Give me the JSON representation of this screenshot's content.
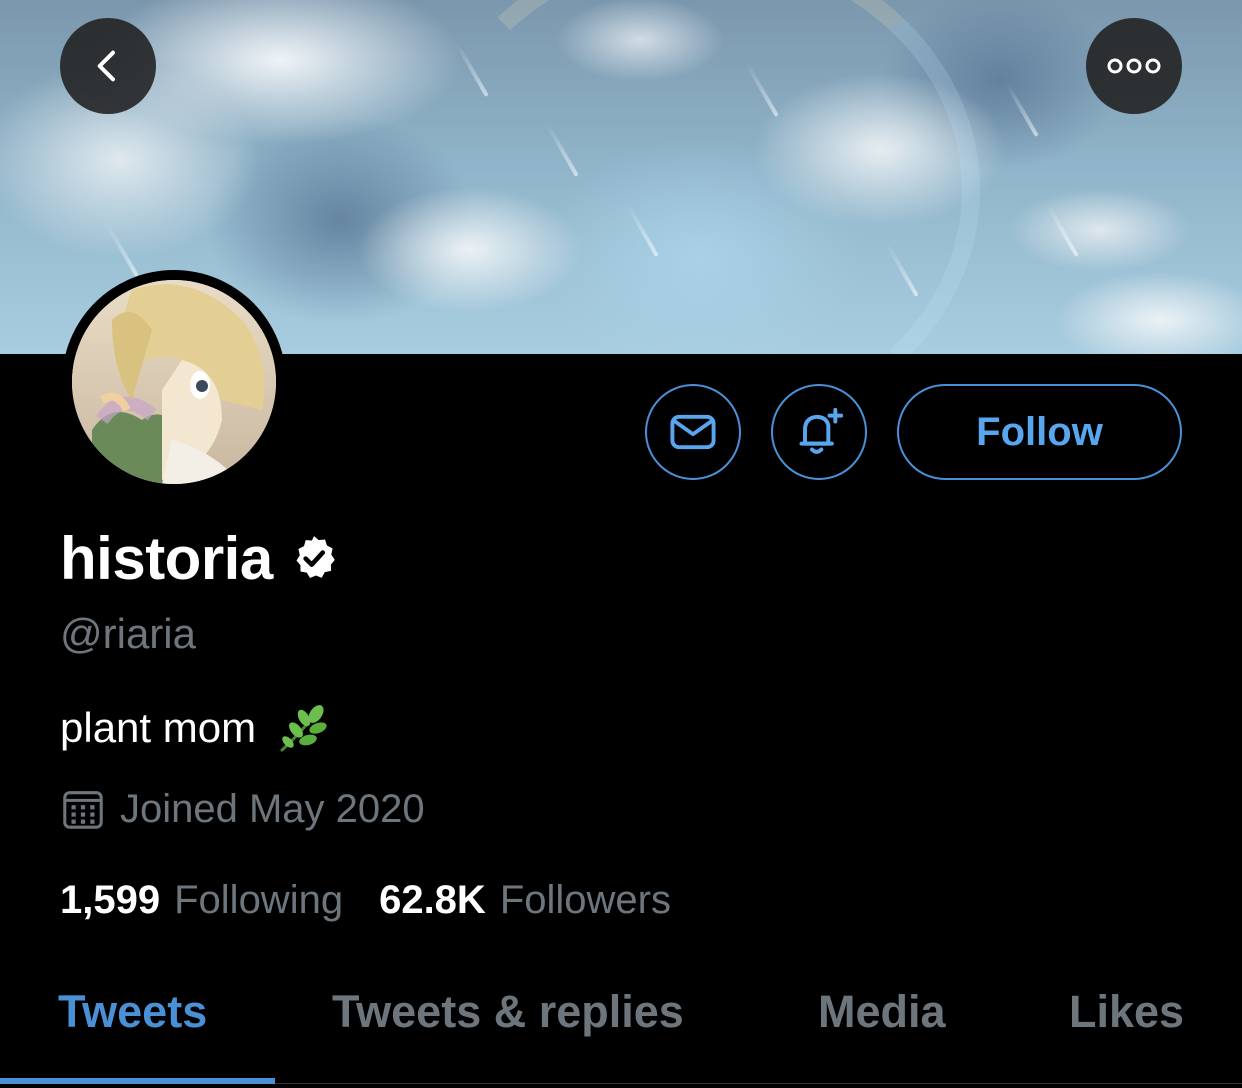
{
  "header": {
    "back_icon": "chevron-left-icon",
    "more_icon": "more-horizontal-icon"
  },
  "profile": {
    "display_name": "historia",
    "verified_icon": "verified-badge-icon",
    "handle": "@riaria",
    "bio": "plant mom",
    "bio_emoji_icon": "herb-leaf-icon",
    "joined": "Joined May 2020",
    "joined_icon": "calendar-icon"
  },
  "actions": {
    "message_icon": "mail-icon",
    "notify_icon": "bell-plus-icon",
    "follow_label": "Follow"
  },
  "stats": {
    "following_count": "1,599",
    "following_label": "Following",
    "followers_count": "62.8K",
    "followers_label": "Followers"
  },
  "tabs": [
    {
      "label": "Tweets",
      "active": true
    },
    {
      "label": "Tweets & replies",
      "active": false
    },
    {
      "label": "Media",
      "active": false
    },
    {
      "label": "Likes",
      "active": false
    }
  ],
  "colors": {
    "accent": "#4a90d6",
    "muted_text": "#6e767d",
    "background": "#000000"
  }
}
